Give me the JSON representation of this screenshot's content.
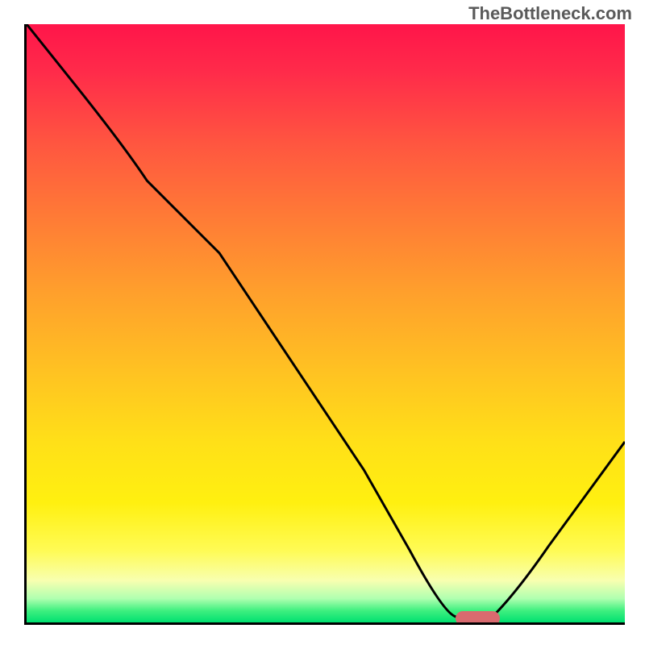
{
  "watermark": "TheBottleneck.com",
  "chart_data": {
    "type": "line",
    "title": "",
    "xlabel": "",
    "ylabel": "",
    "xlim": [
      0,
      100
    ],
    "ylim": [
      0,
      100
    ],
    "grid": false,
    "legend": false,
    "background": "gradient-red-to-green-vertical",
    "series": [
      {
        "name": "bottleneck-curve",
        "color": "#000000",
        "x": [
          0,
          8,
          16,
          24,
          32,
          40,
          48,
          56,
          64,
          70,
          74,
          78,
          82,
          100
        ],
        "y": [
          100,
          90,
          80,
          74,
          62,
          50,
          38,
          26,
          12,
          3,
          1,
          1,
          5,
          30
        ]
      }
    ],
    "marker": {
      "type": "pill",
      "x_center": 75,
      "y_center": 0.8,
      "color": "#d96a6f"
    }
  }
}
